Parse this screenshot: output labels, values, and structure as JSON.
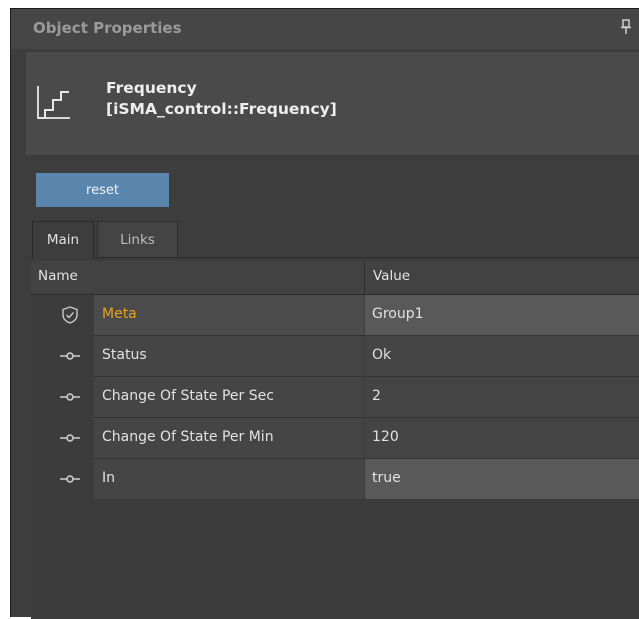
{
  "panel": {
    "title": "Object Properties",
    "pin_icon": "pin-icon"
  },
  "object": {
    "icon": "step-function-icon",
    "name": "Frequency",
    "type": "[iSMA_control::Frequency]"
  },
  "toolbar": {
    "reset_label": "reset"
  },
  "tabs": [
    {
      "label": "Main",
      "active": true
    },
    {
      "label": "Links",
      "active": false
    }
  ],
  "grid": {
    "columns": [
      "Name",
      "Value"
    ],
    "rows": [
      {
        "icon": "shield-check-icon",
        "name": "Meta",
        "value": "Group1",
        "highlight": "#e8a21e"
      },
      {
        "icon": "slot-icon",
        "name": "Status",
        "value": "Ok"
      },
      {
        "icon": "slot-icon",
        "name": "Change Of State Per Sec",
        "value": "2"
      },
      {
        "icon": "slot-icon",
        "name": "Change Of State Per Min",
        "value": "120"
      },
      {
        "icon": "slot-icon",
        "name": "In",
        "value": "true"
      }
    ]
  },
  "colors": {
    "accent_button": "#5a86ad",
    "meta_text": "#e8a21e",
    "panel_bg": "#3d3d3d"
  }
}
